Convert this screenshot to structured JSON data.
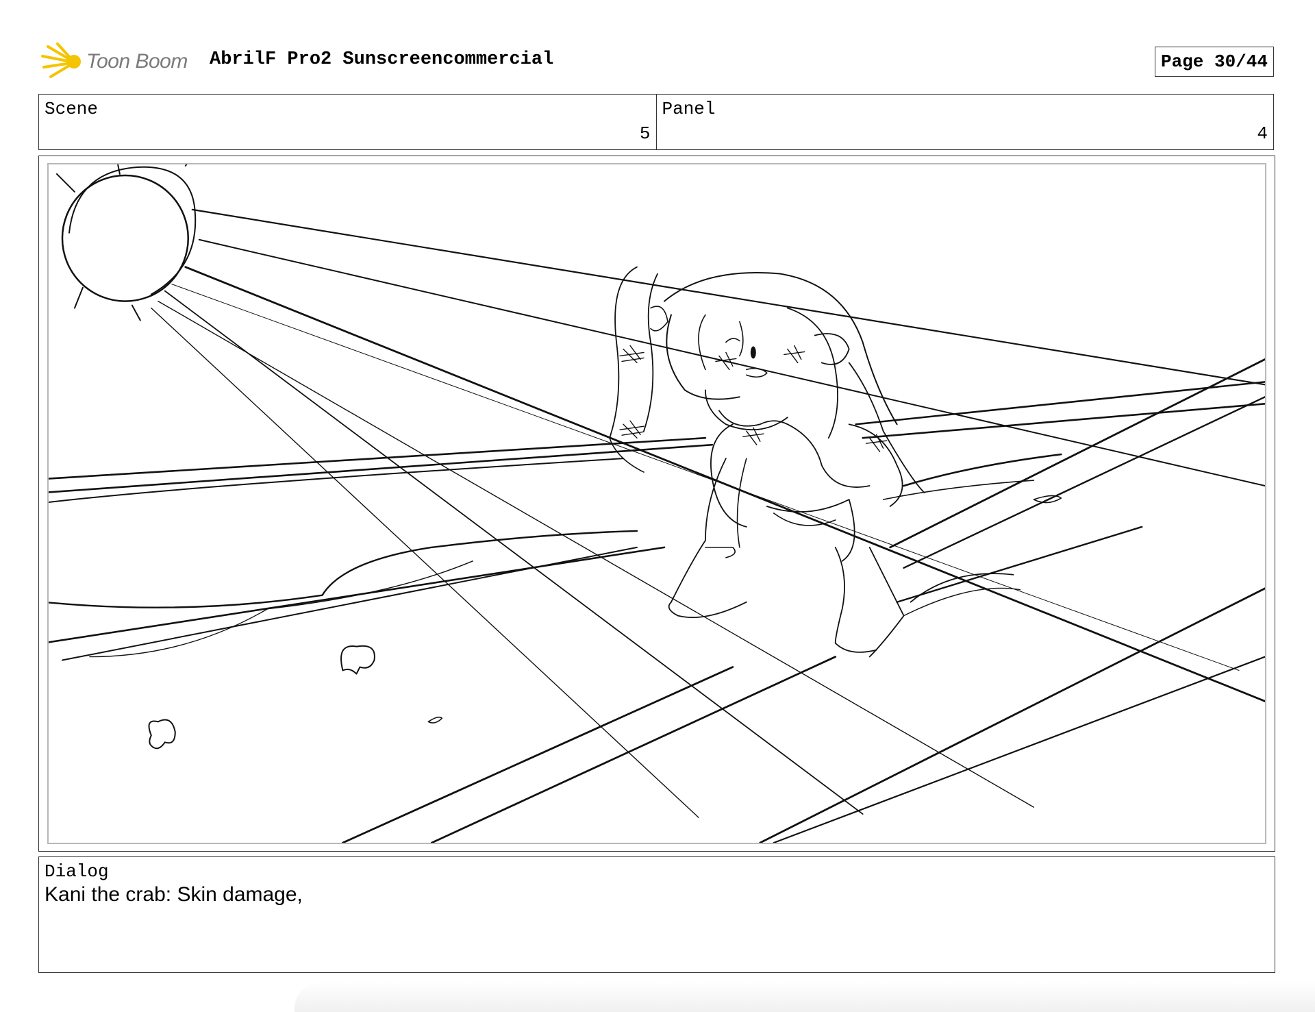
{
  "header": {
    "logo_text": "Toon Boom",
    "logo_icon": "starburst-logo-icon",
    "project_title": "AbrilF Pro2 Sunscreencommercial",
    "page_indicator": "Page 30/44"
  },
  "scene": {
    "label": "Scene",
    "value": "5"
  },
  "panel": {
    "label": "Panel",
    "value": "4"
  },
  "artwork": {
    "description_icon": "storyboard-sketch-image"
  },
  "dialog": {
    "label": "Dialog",
    "text": "Kani the crab: Skin damage,"
  },
  "colors": {
    "logo_yellow": "#f5c400",
    "logo_text_gray": "#7a7a7a",
    "border": "#333333",
    "inner_frame": "#b8b8b8"
  }
}
